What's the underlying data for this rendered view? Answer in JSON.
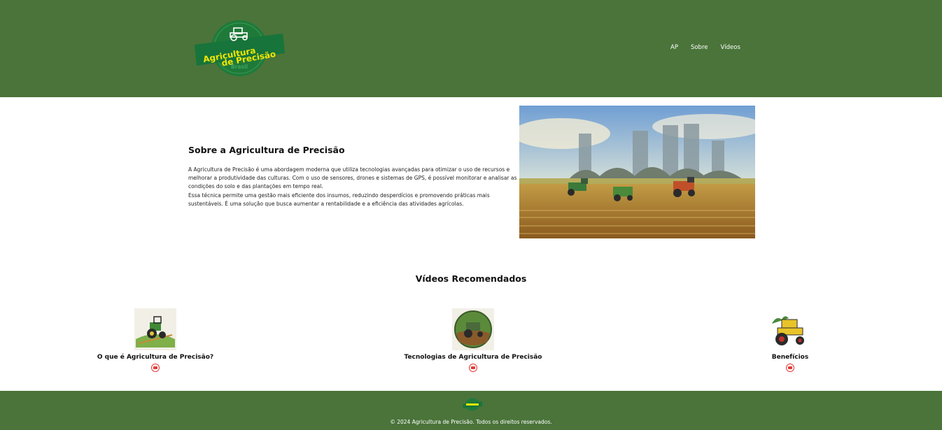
{
  "colors": {
    "brand_green": "#4a743a",
    "logo_green": "#1f7a3a",
    "logo_yellow": "#f2e600",
    "youtube_red": "#e53935"
  },
  "header": {
    "logo": {
      "line1": "Agricultura",
      "line2": "de Precisão",
      "line3": "Brasil",
      "icon": "tractor-icon"
    },
    "nav": [
      {
        "label": "AP"
      },
      {
        "label": "Sobre"
      },
      {
        "label": "Vídeos"
      }
    ]
  },
  "about": {
    "title": "Sobre a Agricultura de Precisão",
    "paragraph1": "A Agricultura de Precisão é uma abordagem moderna que utiliza tecnologias avançadas para otimizar o uso de recursos e melhorar a produtividade das culturas. Com o uso de sensores, drones e sistemas de GPS, é possível monitorar e analisar as condições do solo e das plantações em tempo real.",
    "paragraph2": "Essa técnica permite uma gestão mais eficiente dos insumos, reduzindo desperdícios e promovendo práticas mais sustentáveis. É uma solução que busca aumentar a rentabilidade e a eficiência das atividades agrícolas.",
    "image": "city-wheat-field-tractors-painting"
  },
  "videos": {
    "title": "Vídeos Recomendados",
    "items": [
      {
        "label": "O que é Agricultura de Precisão?",
        "icon": "youtube-icon"
      },
      {
        "label": "Tecnologias de Agricultura de Precisão",
        "icon": "youtube-icon"
      },
      {
        "label": "Benefícios",
        "icon": "youtube-icon"
      }
    ]
  },
  "footer": {
    "text": "© 2024 Agricultura de Precisão. Todos os direitos reservados."
  }
}
